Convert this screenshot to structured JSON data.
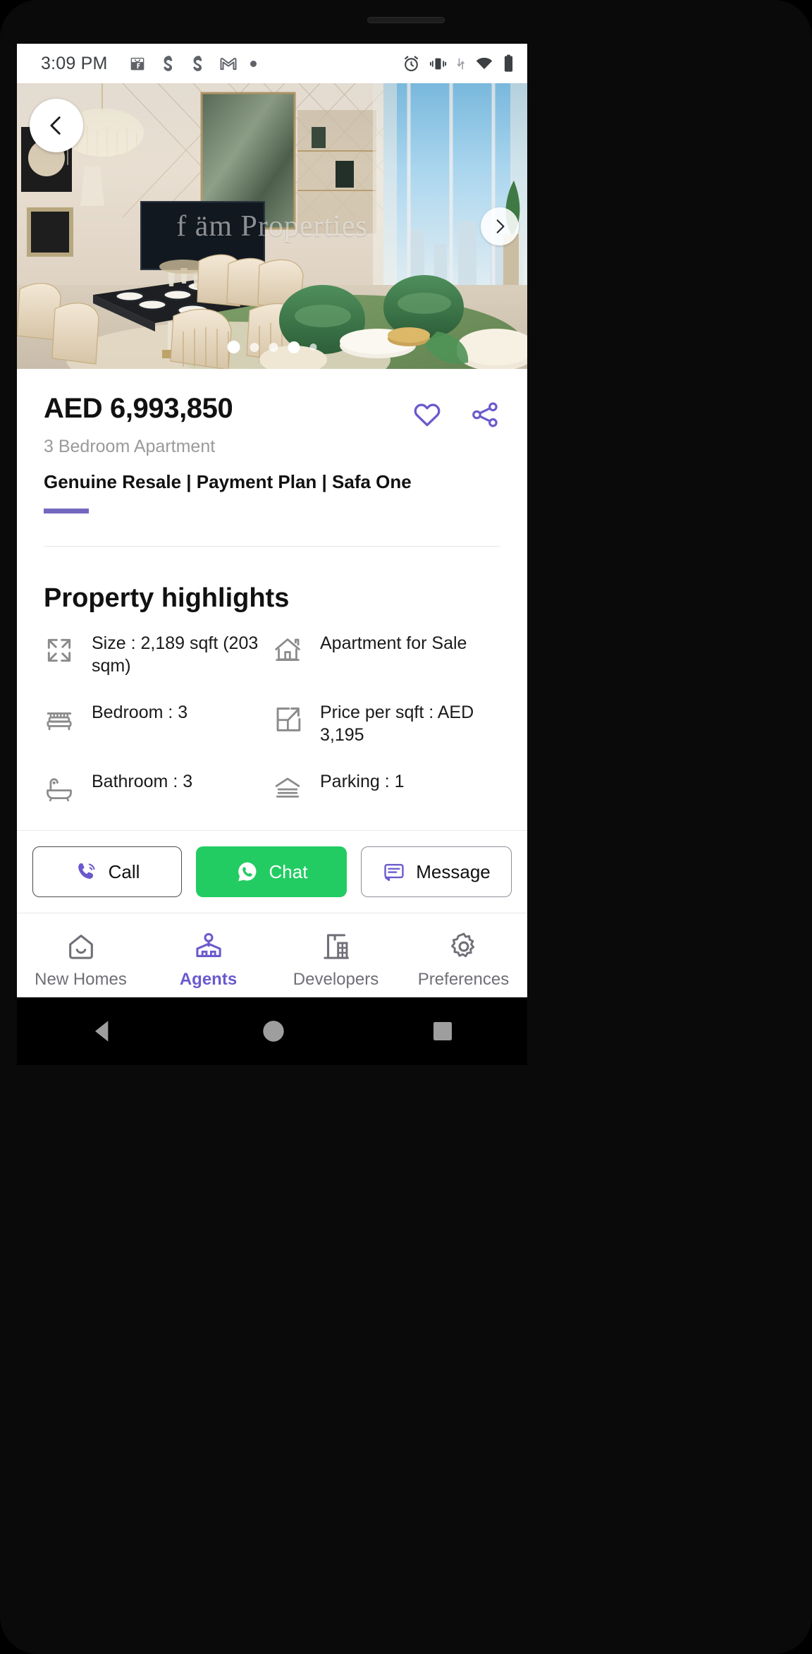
{
  "status_bar": {
    "time": "3:09 PM",
    "left_icons": [
      "flipkart-icon",
      "swiggy-icon",
      "swiggy-icon",
      "gmail-icon",
      "dot-icon"
    ],
    "right_icons": [
      "alarm-icon",
      "vibrate-icon",
      "data-transfer-icon",
      "wifi-icon",
      "battery-icon"
    ]
  },
  "hero": {
    "watermark": "f äm Properties",
    "back_icon": "chevron-left-icon",
    "next_icon": "chevron-right-icon",
    "total_dots": 5,
    "active_dot": 1
  },
  "listing": {
    "price": "AED 6,993,850",
    "subtitle": "3 Bedroom Apartment",
    "title": "Genuine Resale | Payment Plan | Safa One",
    "favorite_icon": "heart-icon",
    "share_icon": "share-icon",
    "accent_color": "#7367c0"
  },
  "highlights": {
    "heading": "Property highlights",
    "items": [
      {
        "icon": "expand-icon",
        "text": "Size : 2,189 sqft (203 sqm)"
      },
      {
        "icon": "house-icon",
        "text": "Apartment for Sale"
      },
      {
        "icon": "bed-icon",
        "text": "Bedroom : 3"
      },
      {
        "icon": "price-area-icon",
        "text": "Price per sqft : AED 3,195"
      },
      {
        "icon": "bathtub-icon",
        "text": "Bathroom : 3"
      },
      {
        "icon": "parking-icon",
        "text": "Parking : 1"
      }
    ]
  },
  "actions": {
    "call": {
      "label": "Call",
      "icon": "phone-icon",
      "color": "#6a5acd"
    },
    "chat": {
      "label": "Chat",
      "icon": "whatsapp-icon",
      "color": "#22cc62"
    },
    "message": {
      "label": "Message",
      "icon": "message-icon",
      "color": "#6a5acd"
    }
  },
  "bottom_nav": {
    "items": [
      {
        "label": "New Homes",
        "icon": "home-outline-icon",
        "active": false
      },
      {
        "label": "Agents",
        "icon": "agent-icon",
        "active": true
      },
      {
        "label": "Developers",
        "icon": "crane-icon",
        "active": false
      },
      {
        "label": "Preferences",
        "icon": "gear-icon",
        "active": false
      }
    ],
    "active_color": "#6a5acd"
  },
  "system_nav": {
    "back": "triangle-back-icon",
    "home": "circle-home-icon",
    "recents": "square-recents-icon"
  }
}
